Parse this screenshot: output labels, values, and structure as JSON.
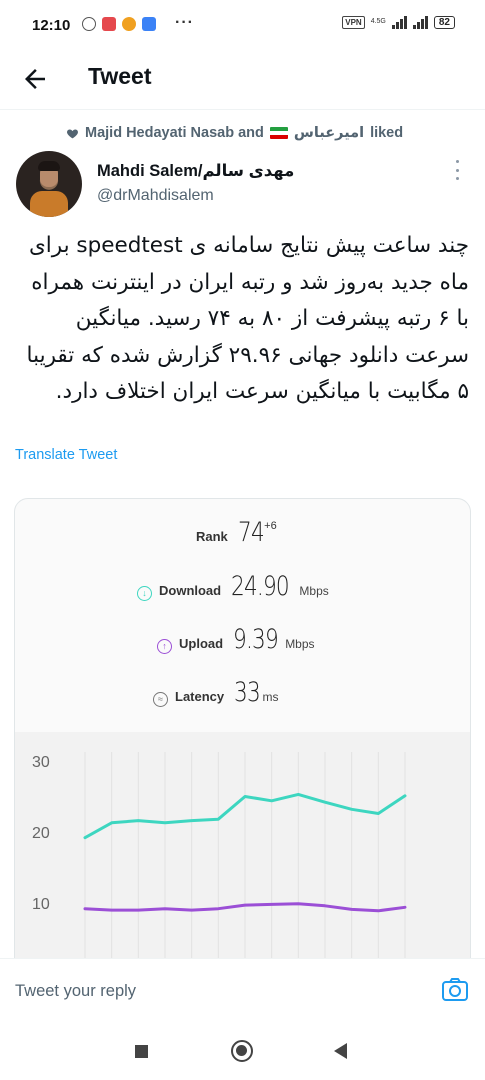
{
  "status_bar": {
    "time": "12:10",
    "dots": "···",
    "vpn": "VPN",
    "network": "4.5G",
    "battery": "82",
    "app_icon_colors": [
      "#e5484d",
      "#f0a020",
      "#3b82f6"
    ]
  },
  "header": {
    "back_icon": "arrow-left-icon",
    "title": "Tweet"
  },
  "social_context": {
    "icon": "heart-icon",
    "name_1": "Majid Hedayati Nasab and",
    "name_2": "امیرعباس",
    "action": "liked"
  },
  "author": {
    "display_name": "Mahdi Salem/مهدی سالم",
    "handle": "@drMahdisalem"
  },
  "tweet": {
    "text": "چند ساعت پیش نتایج سامانه ی speedtest برای ماه جدید به‌روز شد و رتبه ایران در اینترنت همراه با ۶ رتبه پیشرفت از ۸۰ به ۷۴ رسید. میانگین سرعت دانلود جهانی ۲۹.۹۶ گزارش شده که تقریبا ۵ مگابیت با میانگین سرعت ایران اختلاف دارد.",
    "translate_label": "Translate Tweet"
  },
  "media": {
    "rank": {
      "label": "Rank",
      "value": "74",
      "change": "+6"
    },
    "download": {
      "label": "Download",
      "value": "24.90",
      "unit": "Mbps",
      "color": "#3dd6c0"
    },
    "upload": {
      "label": "Upload",
      "value": "9.39",
      "unit": "Mbps",
      "color": "#9b4fd6"
    },
    "latency": {
      "label": "Latency",
      "value": "33",
      "unit": "ms"
    }
  },
  "chart_data": {
    "type": "line",
    "yticks": [
      "30",
      "20",
      "10"
    ],
    "ylim": [
      0,
      33
    ],
    "grid": "vertical",
    "series": [
      {
        "color": "#3dd6c0",
        "values": [
          19.2,
          21.3,
          21.6,
          21.3,
          21.6,
          21.8,
          25.0,
          24.4,
          25.3,
          24.2,
          23.2,
          22.6,
          25.1
        ]
      },
      {
        "color": "#9b4fd6",
        "values": [
          9.2,
          9.0,
          9.0,
          9.2,
          9.0,
          9.2,
          9.7,
          9.8,
          9.9,
          9.6,
          9.1,
          8.9,
          9.4
        ]
      }
    ]
  },
  "reply": {
    "placeholder": "Tweet your reply",
    "camera_icon": "camera-icon"
  }
}
